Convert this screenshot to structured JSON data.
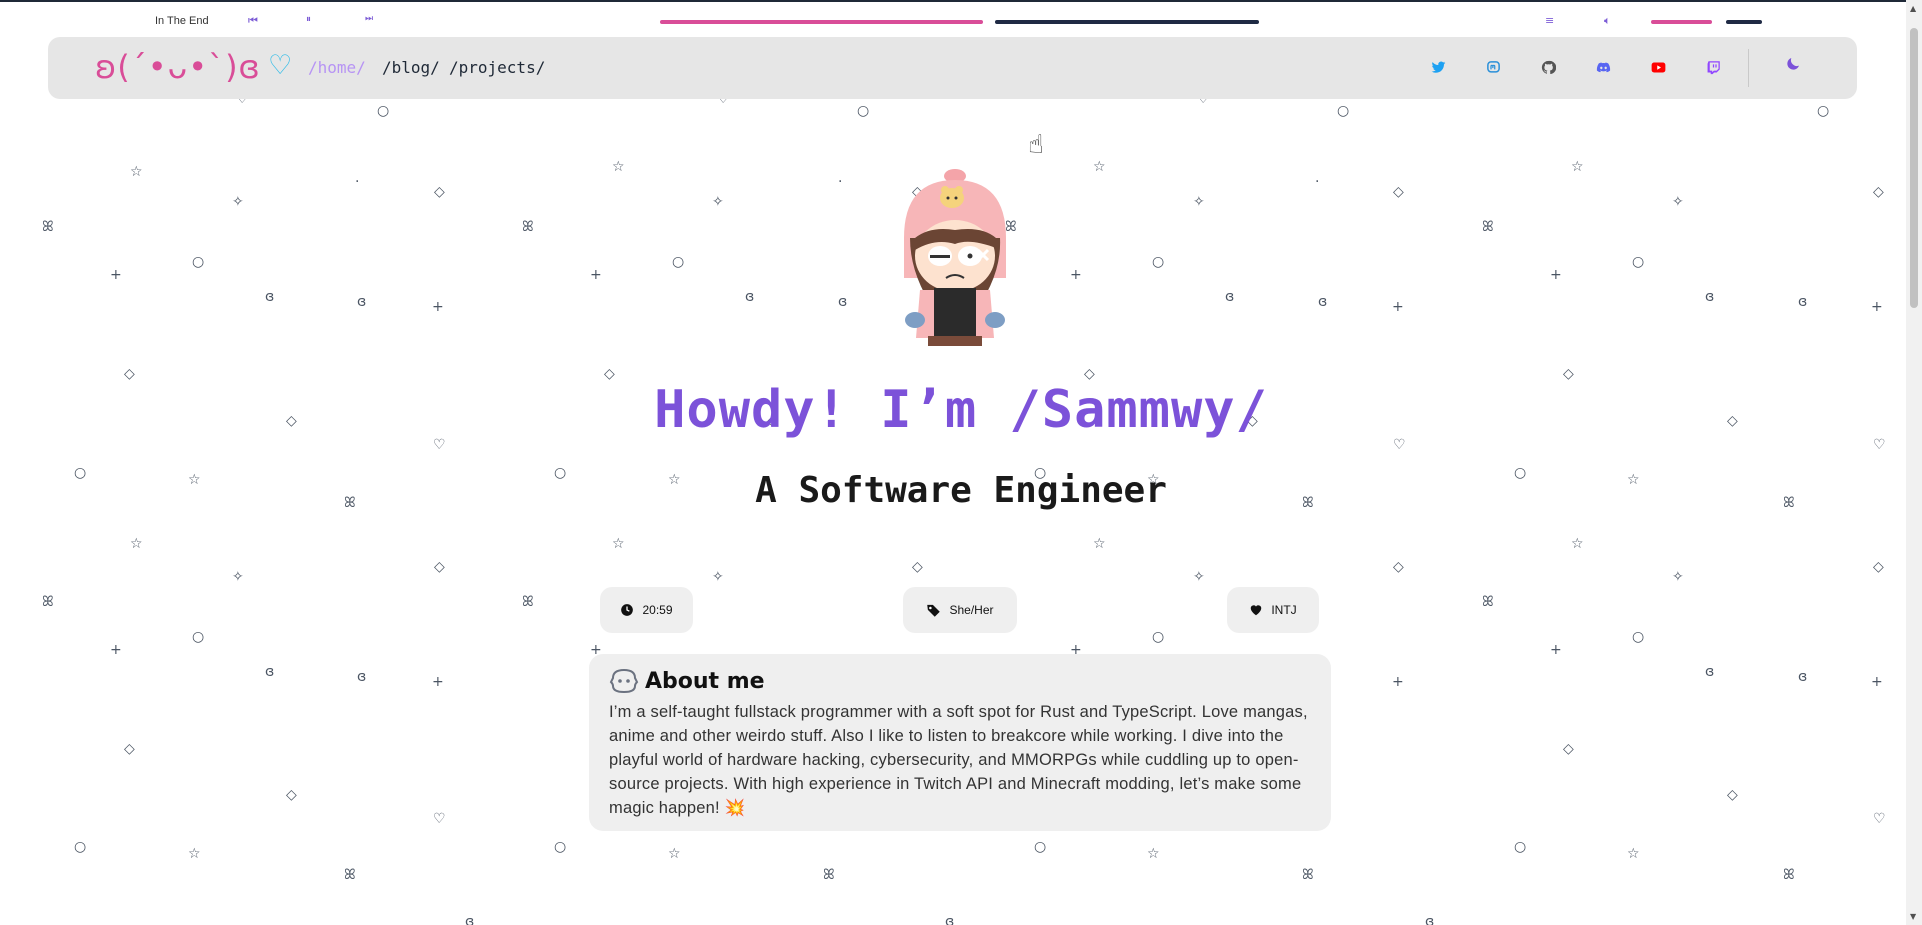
{
  "music_player": {
    "song_title": "In The End",
    "prev_icon": "skip-back-icon",
    "pause_icon": "pause-icon",
    "next_icon": "skip-forward-icon",
    "playlist_icon": "playlist-icon",
    "volume_icon": "volume-icon",
    "progress_fraction": 0.56,
    "volume_fraction": 0.55
  },
  "nav": {
    "logo_text": "ʚ(ˊ•ᴗ•ˋ)ɞ",
    "heart_symbol": "♡",
    "links": [
      {
        "label": "/home/",
        "active": true
      },
      {
        "label": "/blog/",
        "active": false
      },
      {
        "label": "/projects/",
        "active": false
      }
    ],
    "socials": [
      {
        "name": "twitter-icon",
        "color": "#1da1f2"
      },
      {
        "name": "mastodon-icon",
        "color": "#2b90d9"
      },
      {
        "name": "github-icon",
        "color": "#555555"
      },
      {
        "name": "discord-icon",
        "color": "#5865f2"
      },
      {
        "name": "youtube-icon",
        "color": "#ff0000"
      },
      {
        "name": "twitch-icon",
        "color": "#9146ff"
      }
    ],
    "theme_icon": "moon-icon"
  },
  "hero": {
    "title": "Howdy! I’m /Sammwy/",
    "subtitle": "A Software Engineer"
  },
  "info_pills": [
    {
      "icon": "clock-icon",
      "text": "20:59"
    },
    {
      "icon": "tag-icon",
      "text": "She/Her"
    },
    {
      "icon": "heart-icon",
      "text": "INTJ"
    }
  ],
  "about": {
    "title": "About me",
    "text": "I’m a self-taught fullstack programmer with a soft spot for Rust and TypeScript. Love mangas, anime and other weirdo stuff. Also I like to listen to breakcore while working. I dive into the playful world of hardware hacking, cybersecurity, and MMORPGs while cuddling up to open-source projects. With high experience in Twitch API and Minecraft modding, let’s make some magic happen! 💥"
  },
  "colors": {
    "accent_purple": "#7c52d9",
    "accent_pink": "#d94d98",
    "nav_bg": "#e6e6e6",
    "card_bg": "#efefef"
  }
}
